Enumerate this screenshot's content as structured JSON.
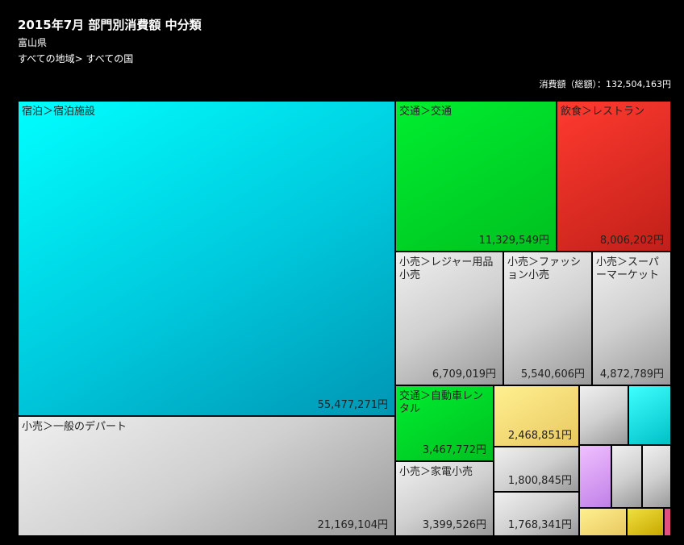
{
  "header": {
    "title": "2015年7月 部門別消費額 中分類",
    "prefecture": "富山県",
    "breadcrumb": "すべての地域> すべての国",
    "total_label": "消費額（総額）：132,504,163円"
  },
  "chart_data": {
    "type": "treemap",
    "total": 132504163,
    "unit": "円",
    "items": [
      {
        "label": "宿泊＞宿泊施設",
        "value": 55477271,
        "value_text": "55,477,271円",
        "color": "#00d8f0"
      },
      {
        "label": "小売＞一般のデパート",
        "value": 21169104,
        "value_text": "21,169,104円",
        "color": "#c8c8c8"
      },
      {
        "label": "交通＞交通",
        "value": 11329549,
        "value_text": "11,329,549円",
        "color": "#00dd28"
      },
      {
        "label": "飲食＞レストラン",
        "value": 8006202,
        "value_text": "8,006,202円",
        "color": "#e02c24"
      },
      {
        "label": "小売＞レジャー用品小売",
        "value": 6709019,
        "value_text": "6,709,019円",
        "color": "#c8c8c8"
      },
      {
        "label": "小売＞ファッション小売",
        "value": 5540606,
        "value_text": "5,540,606円",
        "color": "#c8c8c8"
      },
      {
        "label": "小売＞スーパーマーケット",
        "value": 4872789,
        "value_text": "4,872,789円",
        "color": "#c8c8c8"
      },
      {
        "label": "交通＞自動車レンタル",
        "value": 3467772,
        "value_text": "3,467,772円",
        "color": "#00dd28"
      },
      {
        "label": "小売＞家電小売",
        "value": 3399526,
        "value_text": "3,399,526円",
        "color": "#c8c8c8"
      },
      {
        "label": "",
        "value": 2468851,
        "value_text": "2,468,851円",
        "color": "#f0d878"
      },
      {
        "label": "",
        "value": 1800845,
        "value_text": "1,800,845円",
        "color": "#c8c8c8"
      },
      {
        "label": "",
        "value": 1768341,
        "value_text": "1,768,341円",
        "color": "#c8c8c8"
      }
    ]
  }
}
